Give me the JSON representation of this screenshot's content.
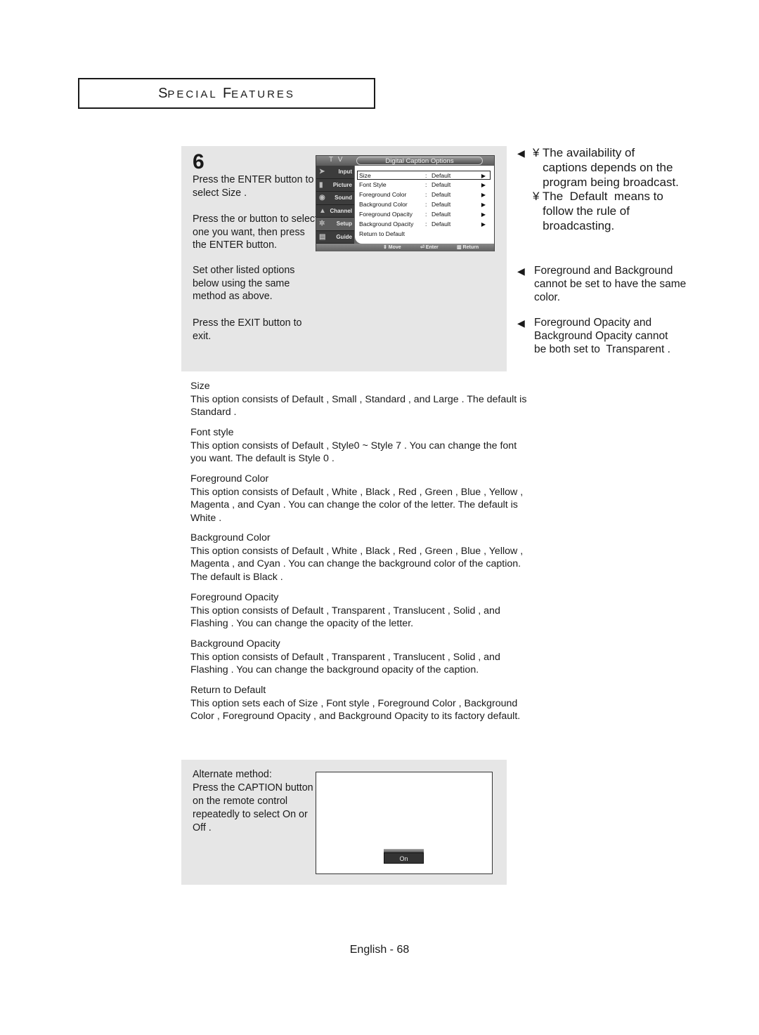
{
  "header": {
    "title_first_cap": "S",
    "title_first_rest": "pecial",
    "title_second_cap": "F",
    "title_second_rest": "eatures"
  },
  "step": {
    "number": "6",
    "paragraphs": [
      "Press the ENTER button to select  Size .",
      "Press the    or    button to select  one you want, then press the ENTER button.",
      "Set other listed options below using the same method as above.",
      "Press the EXIT button to exit."
    ]
  },
  "osd": {
    "tv_label": "T V",
    "title": "Digital Caption Options",
    "sidebar": [
      {
        "label": "Input",
        "icon": "input-icon"
      },
      {
        "label": "Picture",
        "icon": "picture-icon"
      },
      {
        "label": "Sound",
        "icon": "sound-icon"
      },
      {
        "label": "Channel",
        "icon": "channel-icon"
      },
      {
        "label": "Setup",
        "icon": "setup-icon"
      },
      {
        "label": "Guide",
        "icon": "guide-icon"
      }
    ],
    "rows": [
      {
        "label": "Size",
        "value": "Default",
        "colon": ":",
        "arrow": "▶"
      },
      {
        "label": "Font Style",
        "value": "Default",
        "colon": ":",
        "arrow": "▶"
      },
      {
        "label": "Foreground Color",
        "value": "Default",
        "colon": ":",
        "arrow": "▶"
      },
      {
        "label": "Background Color",
        "value": "Default",
        "colon": ":",
        "arrow": "▶"
      },
      {
        "label": "Foreground Opacity",
        "value": "Default",
        "colon": ":",
        "arrow": "▶"
      },
      {
        "label": "Background Opacity",
        "value": "Default",
        "colon": ":",
        "arrow": "▶"
      },
      {
        "label": "Return to Default"
      }
    ],
    "footer": {
      "move": "⇕ Move",
      "enter": "⏎ Enter",
      "return": "▥ Return"
    }
  },
  "notes": {
    "bullet_arrow": "◀",
    "note1_a": "¥ The availability of\n   captions depends on the\n   program being broadcast.",
    "note1_b": "¥ The  Default  means to\n   follow the rule of\n   broadcasting.",
    "note2": "Foreground and Background\ncannot be set to have the same\ncolor.",
    "note3": "Foreground Opacity and\nBackground Opacity cannot\nbe both set to  Transparent ."
  },
  "descriptions": [
    {
      "title": "Size",
      "body": "This option consists of  Default ,  Small ,  Standard , and  Large . The default is  Standard ."
    },
    {
      "title": "Font style",
      "body": "This option consists of  Default ,  Style0 ~ Style 7 . You can change the font you want. The default is  Style 0 ."
    },
    {
      "title": "Foreground Color",
      "body": "This option consists of  Default ,  White ,  Black ,  Red ,  Green ,  Blue ,  Yellow ,  Magenta , and  Cyan . You can change the color of the letter. The default is  White ."
    },
    {
      "title": "Background Color",
      "body": "This option consists of  Default ,  White ,  Black ,  Red ,  Green ,  Blue ,  Yellow ,  Magenta , and  Cyan . You can change the background color of the caption. The default is  Black ."
    },
    {
      "title": "Foreground Opacity",
      "body": "This option consists of  Default ,  Transparent ,  Translucent ,  Solid , and  Flashing . You can change the opacity of the letter."
    },
    {
      "title": "Background Opacity",
      "body": "This option consists of  Default ,  Transparent ,  Translucent ,  Solid , and  Flashing . You can change the background opacity of the caption."
    },
    {
      "title": "Return to Default",
      "body": "This option sets each of  Size ,  Font style ,  Foreground Color ,  Background Color ,  Foreground Opacity , and  Background Opacity  to its  factory default."
    }
  ],
  "alternate": {
    "text": "Alternate method:\nPress the CAPTION button\non the remote control\nrepeatedly to select  On  or\n Off .",
    "badge": "On"
  },
  "footer": {
    "page": "English - 68"
  }
}
